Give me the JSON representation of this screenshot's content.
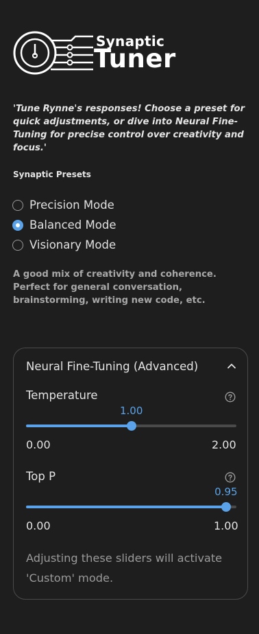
{
  "logo": {
    "title_small": "Synaptic",
    "title_big": "Tuner"
  },
  "intro_text": "'Tune Rynne's responses! Choose a preset for quick adjustments, or dive into Neural Fine-Tuning for precise control over creativity and focus.'",
  "presets": {
    "heading": "Synaptic Presets",
    "options": [
      {
        "label": "Precision Mode",
        "checked": false
      },
      {
        "label": "Balanced Mode",
        "checked": true
      },
      {
        "label": "Visionary Mode",
        "checked": false
      }
    ],
    "description": "A good mix of creativity and coherence. Perfect for general conversation, brainstorming, writing new code, etc."
  },
  "fine_tuning": {
    "title": "Neural Fine-Tuning (Advanced)",
    "expanded": true,
    "sliders": [
      {
        "label": "Temperature",
        "value": "1.00",
        "min": "0.00",
        "max": "2.00",
        "fraction": 0.5
      },
      {
        "label": "Top P",
        "value": "0.95",
        "min": "0.00",
        "max": "1.00",
        "fraction": 0.95
      }
    ],
    "note": "Adjusting these sliders will activate 'Custom' mode."
  },
  "colors": {
    "accent": "#5aa3ea",
    "background": "#1e1e1e",
    "track": "#4a4a4a"
  }
}
